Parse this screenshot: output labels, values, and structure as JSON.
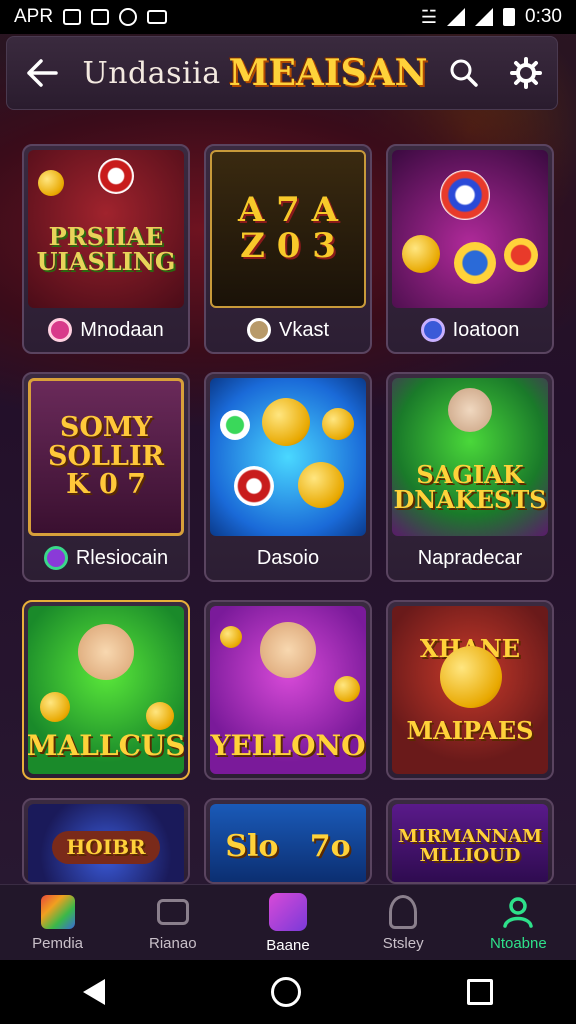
{
  "status_bar": {
    "left": "APR",
    "time": "0:30"
  },
  "header": {
    "title_main": "Undasiia",
    "title_accent": "MEAISAN"
  },
  "cards": [
    {
      "label": "Mnodaan",
      "art_text": "PRSIIAE\nUIASLING"
    },
    {
      "label": "Vkast",
      "art_text": "A 7 A\nZ 0 3"
    },
    {
      "label": "Ioatoon",
      "art_text": ""
    },
    {
      "label": "Rlesiocain",
      "art_text": "SOMY\nSOLLIR\nK 0 7"
    },
    {
      "label": "Dasoio",
      "art_text": ""
    },
    {
      "label": "Napradecar",
      "art_text": "SAGIAK\nDNAKESTS"
    },
    {
      "label": "",
      "art_text": "MALLCUS"
    },
    {
      "label": "",
      "art_text": "YELLONO"
    },
    {
      "label": "",
      "art_text": "XHANE\nMAIPAES"
    },
    {
      "label": "",
      "art_text": "HOIBR"
    },
    {
      "label": "",
      "art_text": "Slo   7o"
    },
    {
      "label": "",
      "art_text": "MIRMANNAM\nMLLIOUD"
    }
  ],
  "bottom_nav": [
    {
      "label": "Pemdia",
      "icon": "grid-color-icon",
      "color": "#e84a3a"
    },
    {
      "label": "Rianao",
      "icon": "wallet-icon",
      "color": "#8a7f8c"
    },
    {
      "label": "Baane",
      "icon": "game-icon",
      "color": "#c84ad8"
    },
    {
      "label": "Stsley",
      "icon": "trophy-icon",
      "color": "#8a7f8c"
    },
    {
      "label": "Ntoabne",
      "icon": "profile-icon",
      "color": "#2ee08a"
    }
  ]
}
